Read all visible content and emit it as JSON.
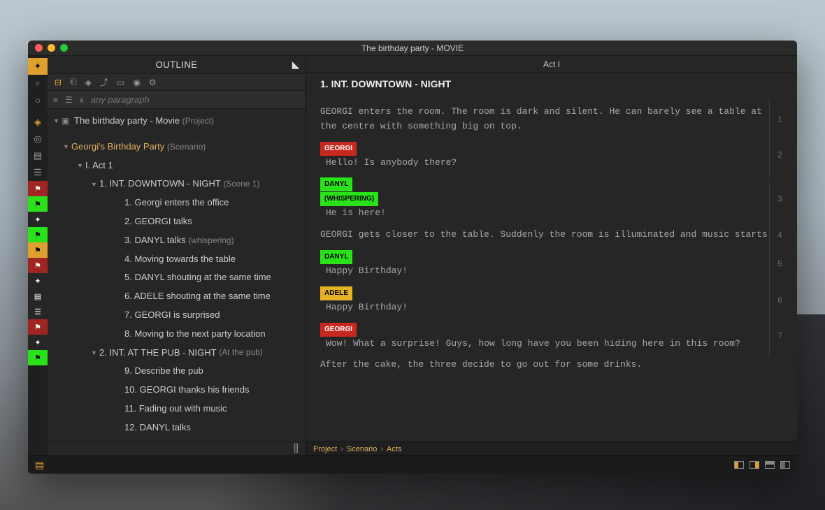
{
  "window_title": "The birthday party - MOVIE",
  "outline_title": "OUTLINE",
  "search_placeholder": "any paragraph",
  "act_header": "Act I",
  "scene_heading": "1. INT.  DOWNTOWN - NIGHT",
  "breadcrumb": {
    "i0": "Project",
    "i1": "Scenario",
    "i2": "Acts"
  },
  "tree": {
    "project": "The birthday party - Movie",
    "project_note": "(Project)",
    "scenario": "Georgi's Birthday Party",
    "scenario_note": "(Scenario)",
    "act1": "I. Act 1",
    "scene1": "1. INT.  DOWNTOWN - NIGHT",
    "scene1_note": "(Scene 1)",
    "b1": "1. Georgi enters the office",
    "b2": "2. GEORGI talks",
    "b3": "3. DANYL talks",
    "b3_note": "(whispering)",
    "b4": "4. Moving towards the table",
    "b5": "5. DANYL shouting at the same time",
    "b6": "6. ADELE shouting at the same time",
    "b7": "7. GEORGI is surprised",
    "b8": "8. Moving to the next party location",
    "scene2": "2. INT.  AT THE PUB - NIGHT",
    "scene2_note": "(At the pub)",
    "b9": "9. Describe the pub",
    "b10": "10. GEORGI thanks his friends",
    "b11": "11. Fading out with music",
    "b12": "12. DANYL talks"
  },
  "script": {
    "action1": "GEORGI enters the room. The room is dark and silent. He can barely see a table at the centre with something big on top.",
    "c1": "GEORGI",
    "d1": "Hello! Is anybody there?",
    "c2a": "DANYL",
    "c2b": "(WHISPERING)",
    "d2": "He is here!",
    "action2": "GEORGI gets closer to the table. Suddenly the room is illuminated and music starts",
    "c3": "DANYL",
    "d3": "Happy Birthday!",
    "c4": "ADELE",
    "d4": "Happy Birthday!",
    "c5": "GEORGI",
    "d5": "Wow! What a surprise! Guys, how long have you been hiding here in this room?",
    "action3": "After the cake, the three decide to go out for some drinks.",
    "n1": "1",
    "n2": "2",
    "n3": "3",
    "n4": "4",
    "n5": "5",
    "n6": "6",
    "n7": "7"
  }
}
